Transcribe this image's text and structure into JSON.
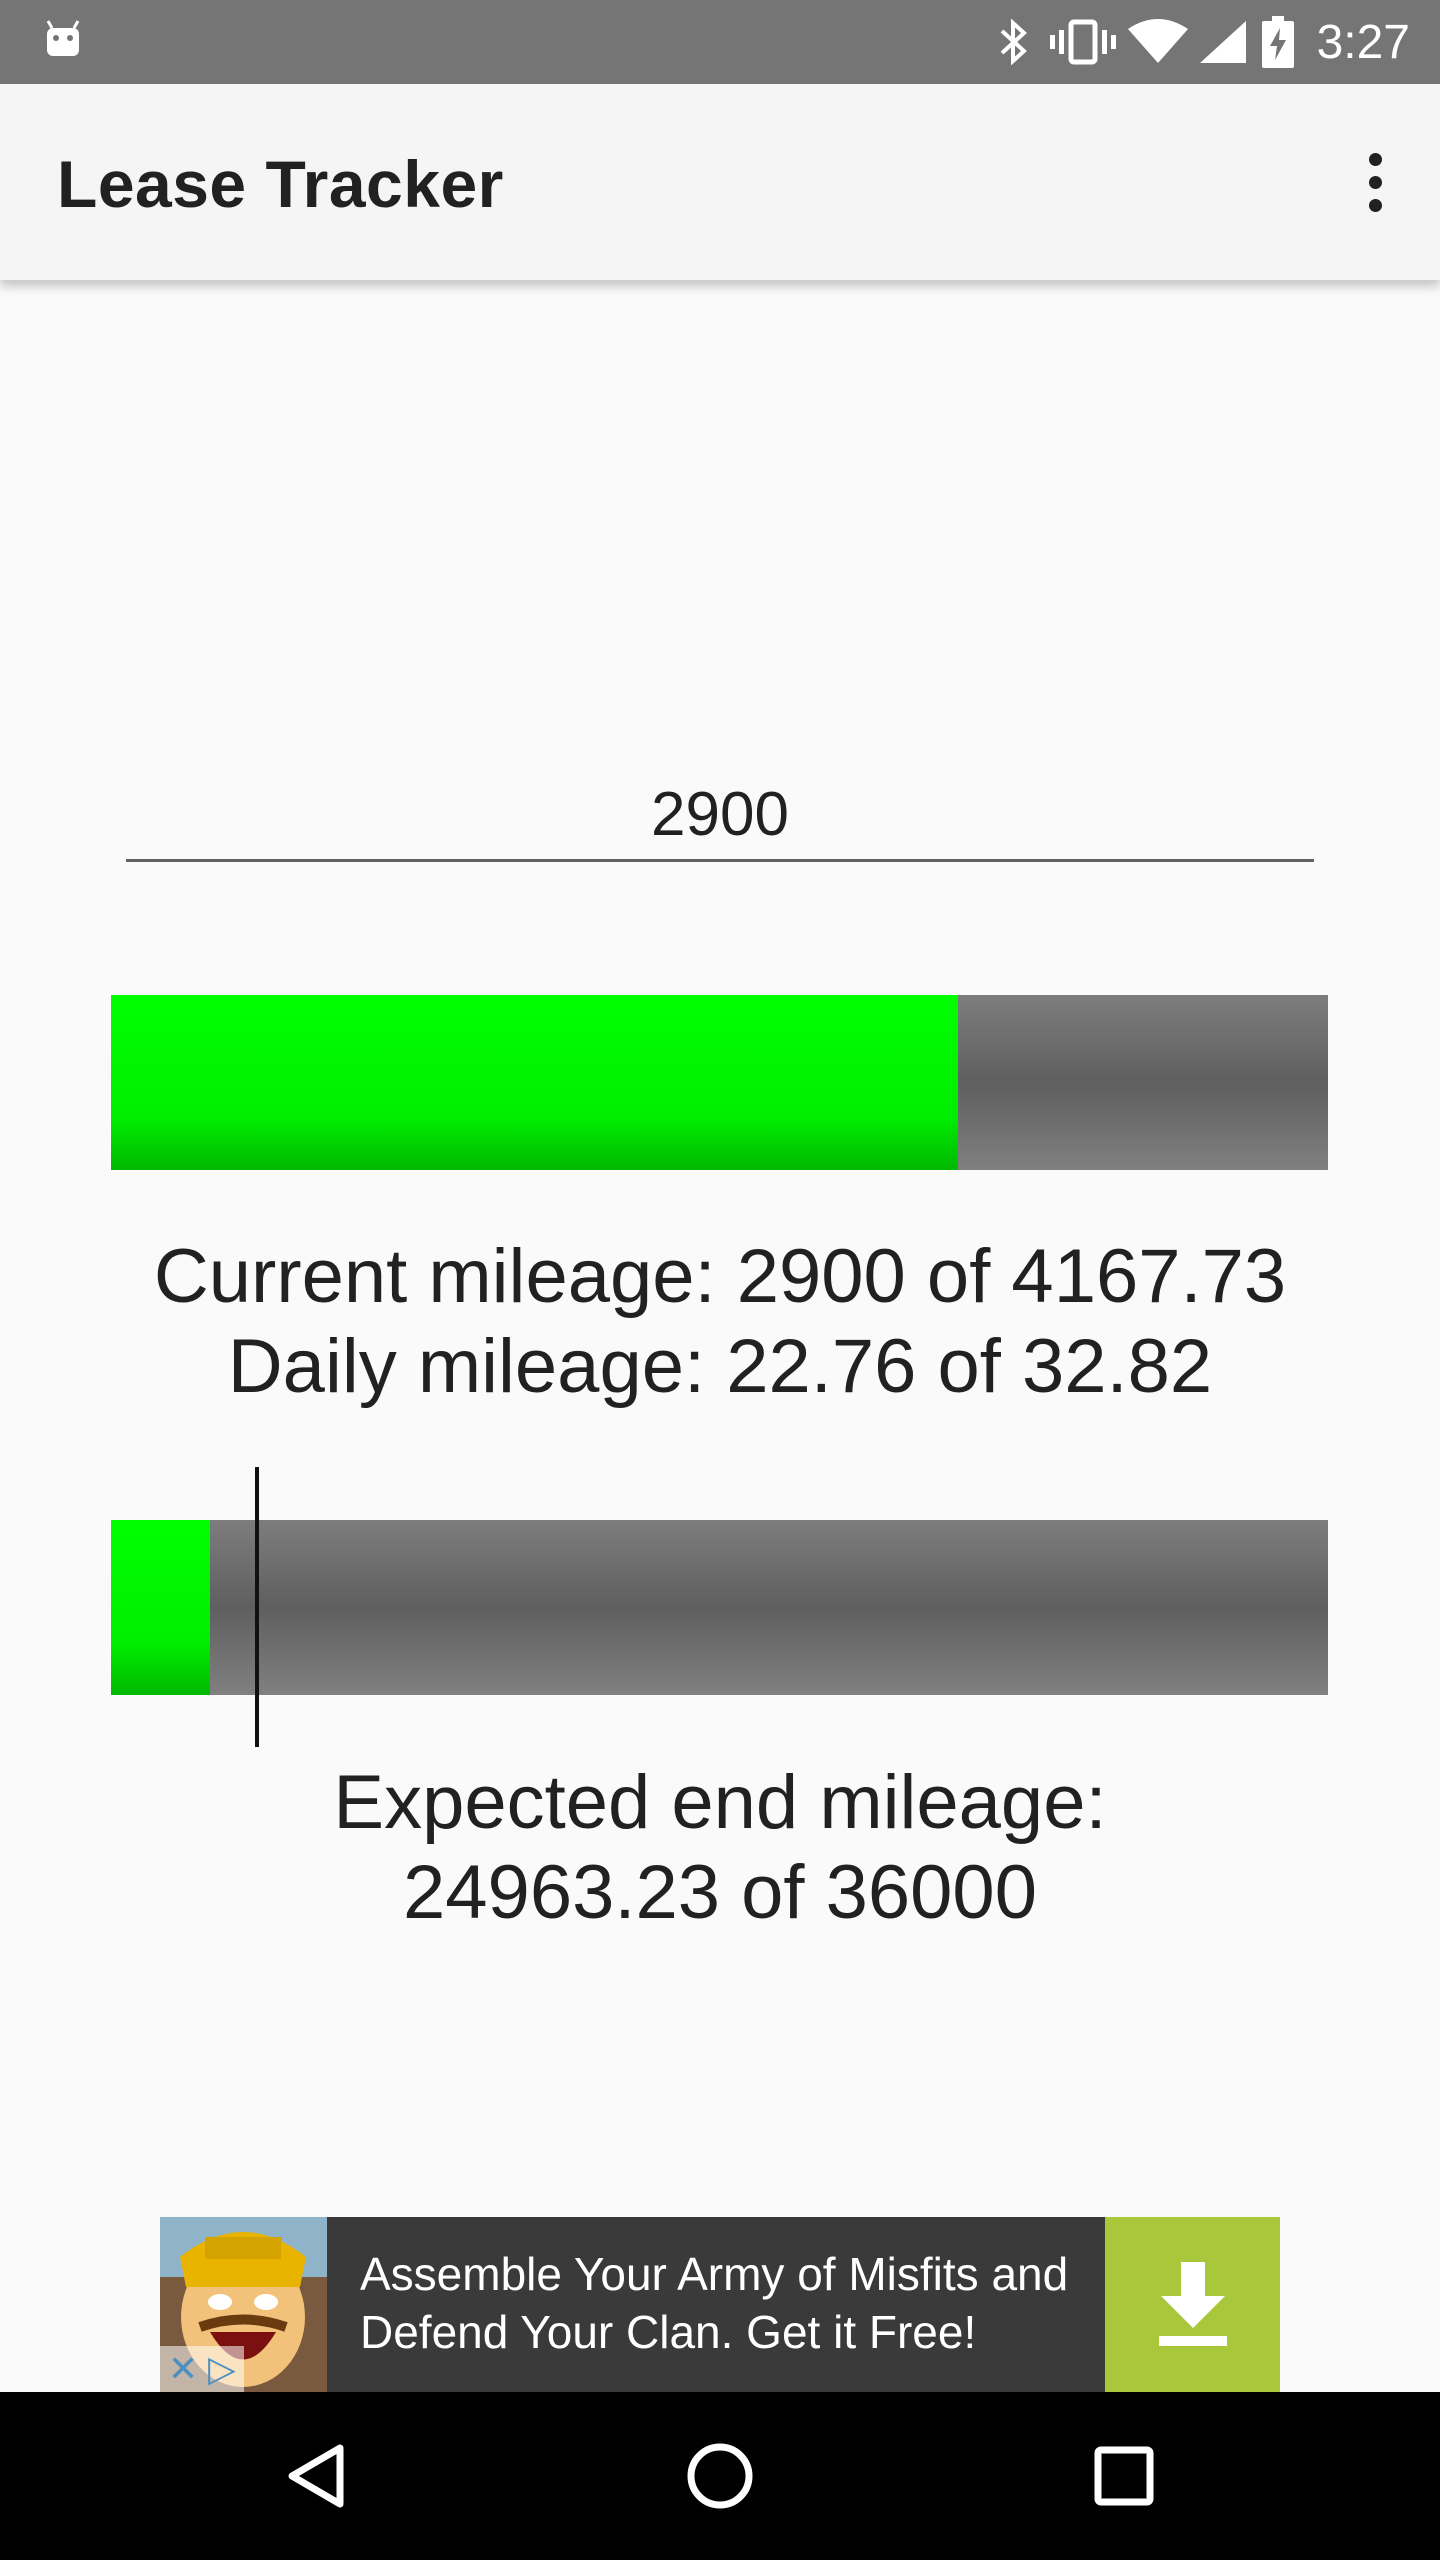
{
  "status_bar": {
    "time": "3:27",
    "icons": [
      "android-icon",
      "bluetooth-icon",
      "vibrate-icon",
      "wifi-icon",
      "signal-icon",
      "battery-charging-icon"
    ]
  },
  "app_bar": {
    "title": "Lease Tracker",
    "menu_icon": "more-vert-icon"
  },
  "mileage_input": {
    "value": "2900"
  },
  "current_progress": {
    "fill_fraction": 0.696,
    "current_line": "Current mileage: 2900 of 4167.73",
    "daily_line": "Daily mileage: 22.76 of 32.82"
  },
  "expected_progress": {
    "fill_fraction": 0.081,
    "marker_fraction": 0.118,
    "line1": "Expected end mileage:",
    "line2": "24963.23 of 36000"
  },
  "colors": {
    "fill": "#00ff00",
    "track": "#6e6e6e",
    "ad_download": "#a8c73a"
  },
  "ad": {
    "line1": "Assemble Your Army of Misfits and",
    "line2": "Defend Your Clan. Get it Free!",
    "download_icon": "download-icon",
    "close_icon": "close-icon",
    "adchoices_icon": "adchoices-icon"
  },
  "nav_bar": {
    "buttons": [
      "back-icon",
      "home-icon",
      "recents-icon"
    ]
  }
}
